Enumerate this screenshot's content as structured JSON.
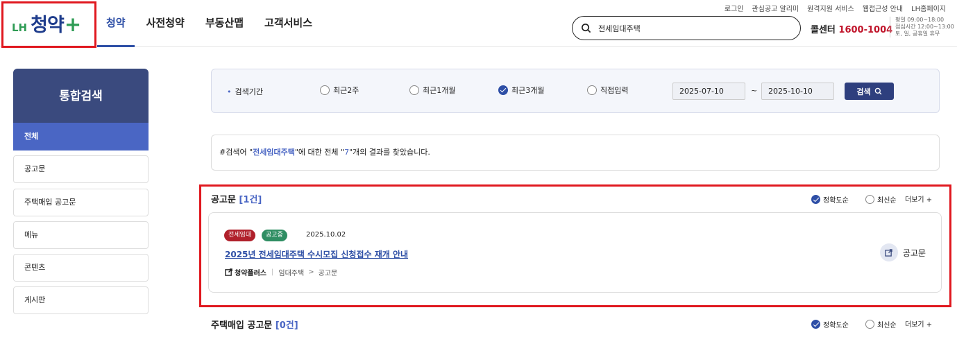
{
  "header": {
    "logo": {
      "lh": "LH",
      "main": "청약",
      "plus": "+"
    },
    "nav": [
      "청약",
      "사전청약",
      "부동산맵",
      "고객서비스"
    ],
    "util_links": [
      "로그인",
      "관심공고 알리미",
      "원격지원 서비스",
      "웹접근성 안내",
      "LH홈페이지"
    ],
    "search_value": "전세임대주택",
    "callcenter_label": "콜센터",
    "callcenter_number": "1600-1004",
    "hours_line1": "평일 09:00~18:00",
    "hours_line2": "점심시간 12:00~13:00",
    "hours_line3": "토, 일, 공휴일 휴무"
  },
  "sidebar": {
    "title": "통합검색",
    "items": [
      "전체",
      "공고문",
      "주택매입 공고문",
      "메뉴",
      "콘텐츠",
      "게시판"
    ]
  },
  "filter": {
    "label": "검색기간",
    "options": [
      "최근2주",
      "최근1개월",
      "최근3개월",
      "직접입력"
    ],
    "selected": "최근3개월",
    "date_from": "2025-07-10",
    "date_to": "2025-10-10",
    "tilde": "~",
    "search_button": "검색"
  },
  "result_msg": {
    "prefix": "#검색어 \"",
    "keyword": "전세임대주택",
    "middle": "\"에 대한 전체 \"",
    "count": "7",
    "suffix": "\"개의 결과를 찾았습니다."
  },
  "sections": [
    {
      "title": "공고문",
      "count": "[1건]",
      "sort_options": [
        "정확도순",
        "최신순"
      ],
      "more": "더보기 +",
      "items": [
        {
          "badges": [
            "전세임대",
            "공고중"
          ],
          "date": "2025.10.02",
          "title": "2025년 전세임대주택 수시모집 신청접수 재개 안내",
          "source": "청약플러스",
          "sep": "|",
          "path1": "임대주택",
          "gt": ">",
          "path2": "공고문",
          "link_label": "공고문"
        }
      ]
    },
    {
      "title": "주택매입 공고문",
      "count": "[0건]",
      "sort_options": [
        "정확도순",
        "최신순"
      ],
      "more": "더보기 +"
    }
  ],
  "colors": {
    "accent": "#2e4fa6",
    "sidebar_title_bg": "#3a4a7e",
    "highlight_border": "#e0181f"
  }
}
